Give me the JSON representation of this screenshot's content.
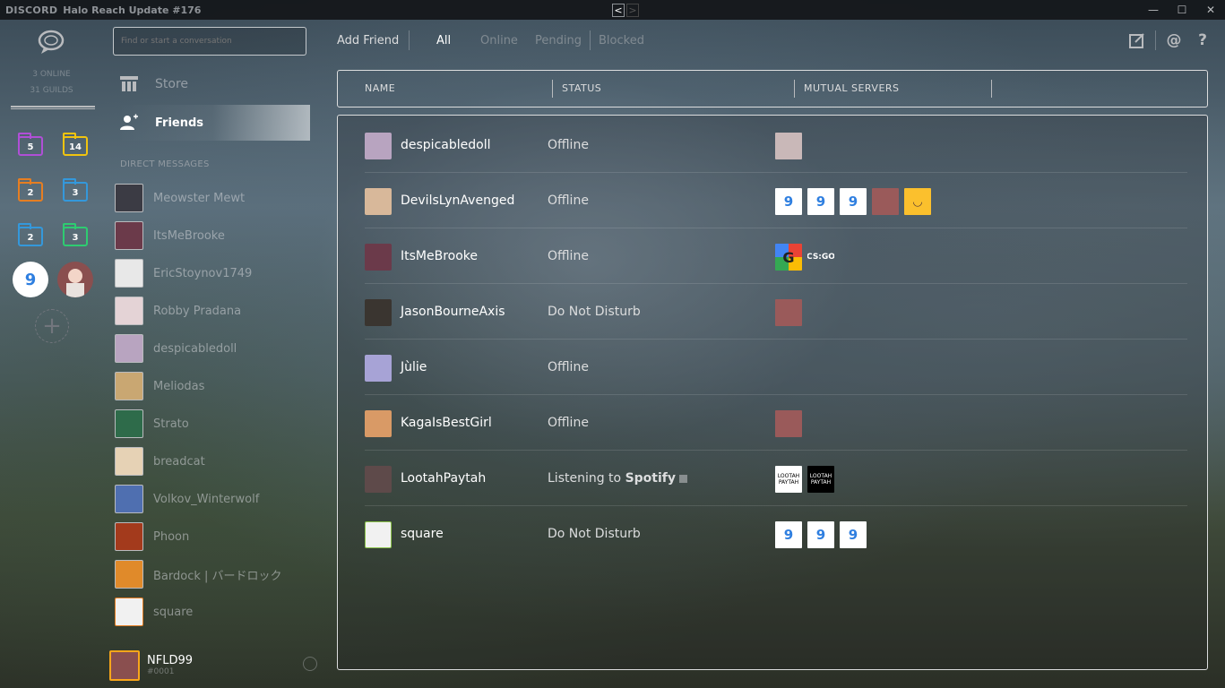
{
  "window": {
    "brand": "DISCORD",
    "title": "Halo Reach Update #176",
    "back": "<",
    "forward": ">"
  },
  "guilds": {
    "online": "3 ONLINE",
    "guild_count": "31 GUILDS",
    "folders": [
      {
        "count": "5",
        "color": "#b04fd6"
      },
      {
        "count": "14",
        "color": "#f1c40f"
      },
      {
        "count": "2",
        "color": "#e67e22"
      },
      {
        "count": "3",
        "color": "#3498db"
      },
      {
        "count": "2",
        "color": "#3498db"
      },
      {
        "count": "3",
        "color": "#2ecc71"
      }
    ],
    "add_label": "+"
  },
  "search": {
    "placeholder": "Find or start a conversation"
  },
  "nav": {
    "store": "Store",
    "friends": "Friends"
  },
  "dm_header": "DIRECT MESSAGES",
  "dms": [
    {
      "name": "Meowster Mewt",
      "color": "#3b3b44"
    },
    {
      "name": "ItsMeBrooke",
      "color": "#6b3a4a"
    },
    {
      "name": "EricStoynov1749",
      "color": "#e8e8e8"
    },
    {
      "name": "Robby Pradana",
      "color": "#e4d3d6"
    },
    {
      "name": "despicabledoll",
      "color": "#b8a4c0"
    },
    {
      "name": "Meliodas",
      "color": "#c9a772"
    },
    {
      "name": "Strato",
      "color": "#2e6b4a"
    },
    {
      "name": "breadcat",
      "color": "#e6d2b5"
    },
    {
      "name": "Volkov_Winterwolf",
      "color": "#4f6fb0"
    },
    {
      "name": "Phoon",
      "color": "#a33a1c"
    },
    {
      "name": "Bardock | バードロック",
      "color": "#e08a2a"
    },
    {
      "name": "square",
      "color": "#f1f1f1"
    }
  ],
  "user": {
    "name": "NFLD99",
    "tag": "#0001"
  },
  "topbar": {
    "add_friend": "Add Friend",
    "tabs": [
      "All",
      "Online",
      "Pending",
      "Blocked"
    ],
    "icons": [
      "new-group-dm-icon",
      "mention-icon",
      "help-icon"
    ]
  },
  "columns": {
    "name": "NAME",
    "status": "STATUS",
    "mutual": "MUTUAL SERVERS"
  },
  "friends": [
    {
      "name": "despicabledoll",
      "status": "Offline",
      "avatar": "#b8a4c0",
      "servers": [
        {
          "type": "img",
          "color": "#c9b8b8"
        }
      ]
    },
    {
      "name": "DevilsLynAvenged",
      "status": "Offline",
      "avatar": "#d8b89a",
      "servers": [
        {
          "type": "ninja",
          "label": "9"
        },
        {
          "type": "ninja",
          "label": "9"
        },
        {
          "type": "ninja",
          "label": "9"
        },
        {
          "type": "img",
          "color": "#9a5a5a"
        },
        {
          "type": "smile",
          "label": "◡"
        }
      ]
    },
    {
      "name": "ItsMeBrooke",
      "status": "Offline",
      "avatar": "#6b3a4a",
      "servers": [
        {
          "type": "g",
          "label": "G"
        },
        {
          "type": "cs",
          "label": "CS:GO"
        }
      ]
    },
    {
      "name": "JasonBourneAxis",
      "status": "Do Not Disturb",
      "avatar": "#3a3530",
      "servers": [
        {
          "type": "img",
          "color": "#9a5a5a"
        }
      ]
    },
    {
      "name": "Jùlie",
      "status": "Offline",
      "avatar": "#a7a3d6",
      "servers": []
    },
    {
      "name": "KagaIsBestGirl",
      "status": "Offline",
      "avatar": "#d99a66",
      "servers": [
        {
          "type": "img",
          "color": "#9a5a5a"
        }
      ]
    },
    {
      "name": "LootahPaytah",
      "status_prefix": "Listening to ",
      "status_strong": "Spotify",
      "avatar": "#5e4a4a",
      "servers": [
        {
          "type": "lootah",
          "label": "LOOTAH PAYTAH"
        },
        {
          "type": "lootah dark",
          "label": "LOOTAH PAYTAH"
        }
      ]
    },
    {
      "name": "square",
      "status": "Do Not Disturb",
      "avatar": "#f1f1f1",
      "servers": [
        {
          "type": "ninja",
          "label": "9"
        },
        {
          "type": "ninja",
          "label": "9"
        },
        {
          "type": "ninja",
          "label": "9"
        }
      ]
    }
  ]
}
